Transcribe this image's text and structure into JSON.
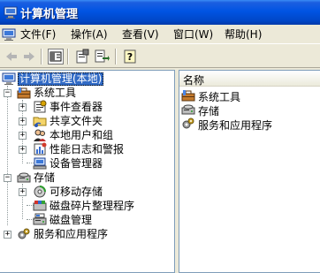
{
  "window": {
    "title": "计算机管理",
    "icon": "computer-management-icon"
  },
  "menu": [
    {
      "label": "文件(F)"
    },
    {
      "label": "操作(A)"
    },
    {
      "label": "查看(V)"
    },
    {
      "label": "窗口(W)"
    },
    {
      "label": "帮助(H)"
    }
  ],
  "toolbar": {
    "buttons": [
      "back-arrow-icon",
      "forward-arrow-icon",
      "show-hide-console-tree-icon",
      "properties-icon",
      "export-list-icon",
      "help-icon"
    ]
  },
  "tree": {
    "root": {
      "label": "计算机管理(本地)",
      "icon": "computer-management-icon",
      "selected": true
    },
    "system_tools": {
      "label": "系统工具",
      "icon": "toolbox-icon",
      "expander": "−",
      "children": [
        {
          "label": "事件查看器",
          "icon": "event-viewer-icon",
          "expander": "+"
        },
        {
          "label": "共享文件夹",
          "icon": "shared-folder-icon",
          "expander": "+"
        },
        {
          "label": "本地用户和组",
          "icon": "users-icon",
          "expander": "+"
        },
        {
          "label": "性能日志和警报",
          "icon": "performance-logs-icon",
          "expander": "+"
        },
        {
          "label": "设备管理器",
          "icon": "device-manager-icon",
          "expander": ""
        }
      ]
    },
    "storage": {
      "label": "存储",
      "icon": "storage-icon",
      "expander": "−",
      "children": [
        {
          "label": "可移动存储",
          "icon": "removable-storage-icon",
          "expander": "+"
        },
        {
          "label": "磁盘碎片整理程序",
          "icon": "defragmenter-icon",
          "expander": ""
        },
        {
          "label": "磁盘管理",
          "icon": "disk-management-icon",
          "expander": ""
        }
      ]
    },
    "services": {
      "label": "服务和应用程序",
      "icon": "services-apps-icon",
      "expander": "+"
    }
  },
  "list": {
    "column_header": "名称",
    "items": [
      {
        "label": "系统工具",
        "icon": "toolbox-icon"
      },
      {
        "label": "存储",
        "icon": "storage-icon"
      },
      {
        "label": "服务和应用程序",
        "icon": "services-apps-icon"
      }
    ]
  },
  "colors": {
    "titlebar": "#0054e3",
    "selection": "#316ac5",
    "chrome": "#ece9d8"
  }
}
